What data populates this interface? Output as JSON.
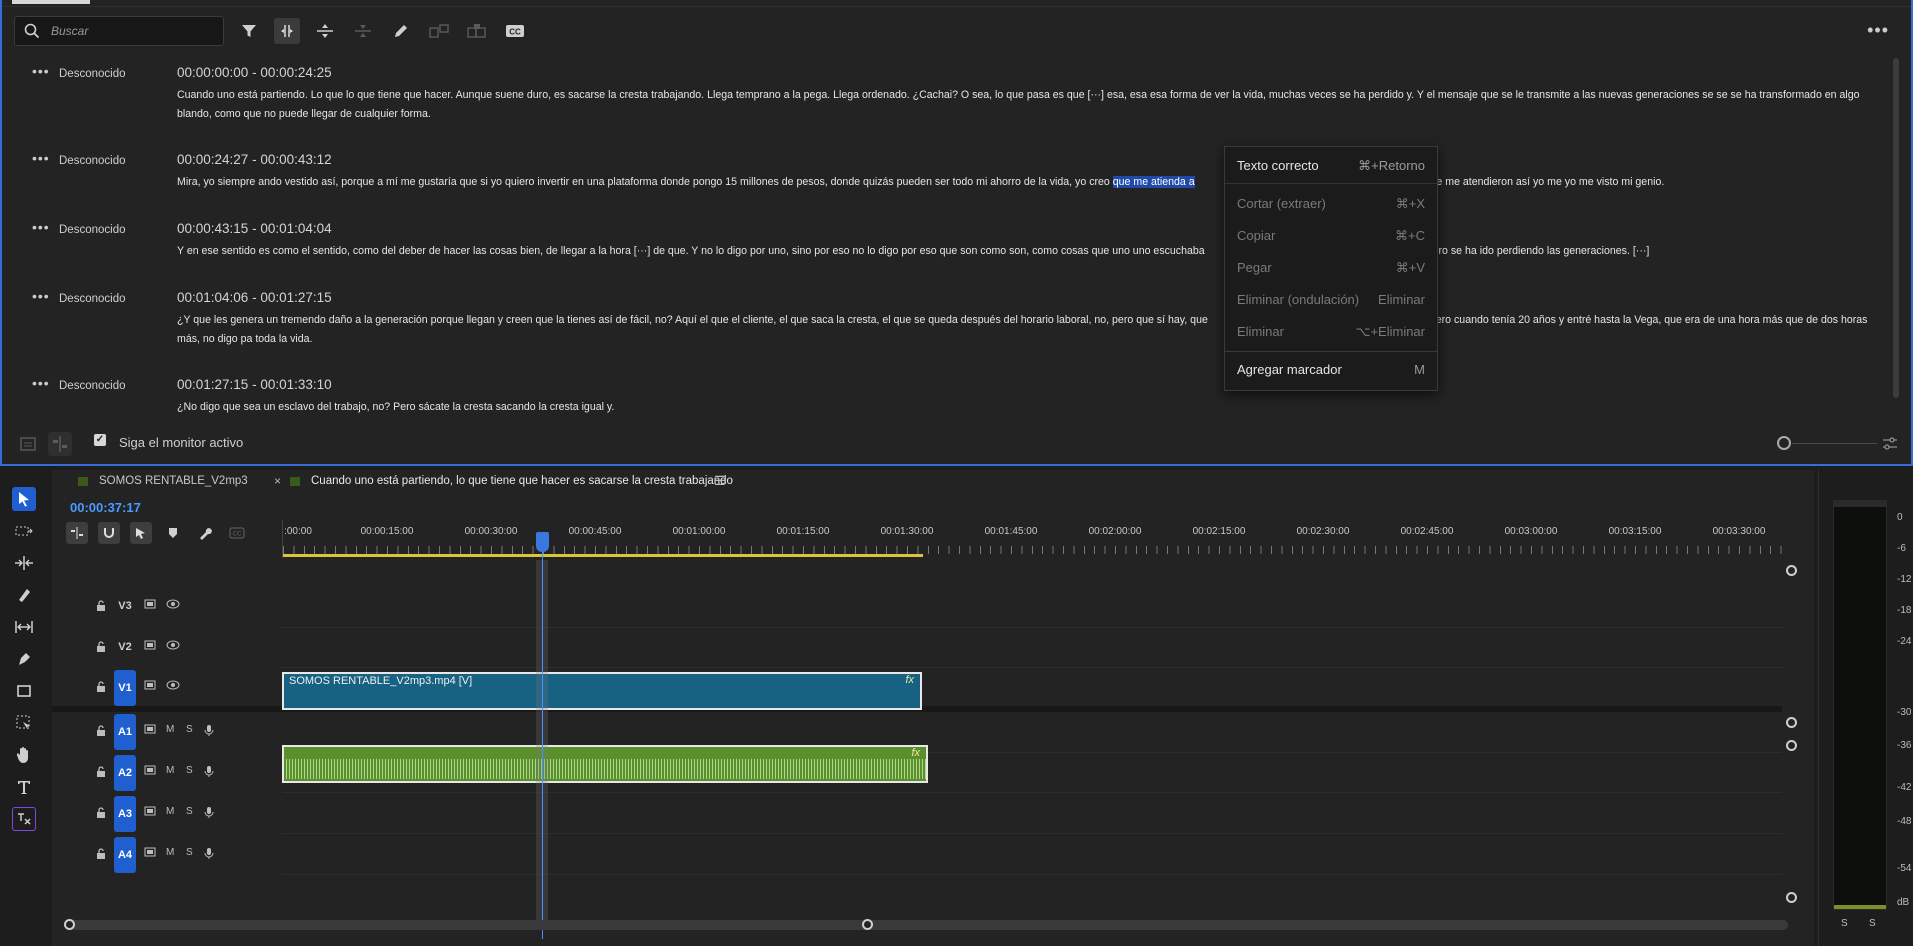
{
  "text_panel": {
    "search": {
      "placeholder": "Buscar"
    },
    "segments": [
      {
        "speaker": "Desconocido",
        "time": "00:00:00:00 - 00:00:24:25",
        "text": "Cuando uno está partiendo. Lo que lo que tiene que hacer. Aunque suene duro, es sacarse la cresta trabajando. Llega temprano a la pega. Llega ordenado. ¿Cachai? O sea, lo que pasa es que [···] esa, esa esa forma de ver la vida, muchas veces se ha perdido y. Y el mensaje que se le transmite a las nuevas generaciones se se se ha transformado en algo blando, como que no puede llegar de cualquier forma."
      },
      {
        "speaker": "Desconocido",
        "time": "00:00:24:27 - 00:00:43:12",
        "text_before": "Mira, yo siempre ando vestido así, porque a mí me gustaría que si yo quiero invertir en una plataforma donde pongo 15 millones de pesos, donde quizás pueden ser todo mi ahorro de la vida, yo creo ",
        "text_highlight": "que me atienda a",
        "text_after": "que me atendieron así yo me yo me visto mi genio."
      },
      {
        "speaker": "Desconocido",
        "time": "00:00:43:15 - 00:01:04:04",
        "text_before": "Y en ese sentido es como el sentido, como del deber de hacer las cosas bien, de llegar a la hora [···] de que. Y no lo digo por uno, sino por eso no lo digo por eso que son como son, como cosas que uno uno escuchaba",
        "text_after": ". Pero se ha ido perdiendo las generaciones. [···]"
      },
      {
        "speaker": "Desconocido",
        "time": "00:01:04:06 - 00:01:27:15",
        "text_before": "¿Y que les genera un tremendo daño a la generación porque llegan y creen que la tienes así de fácil, no? Aquí el que el cliente, el que saca la cresta, el que se queda después del horario laboral, no, pero que sí hay, que",
        "text_after": "pero cuando tenía 20 años y entré hasta la Vega, que era de una hora más que de dos horas más, no digo pa toda la vida."
      },
      {
        "speaker": "Desconocido",
        "time": "00:01:27:15 - 00:01:33:10",
        "text": "¿No digo que sea un esclavo del trabajo, no? Pero sácate la cresta sacando la cresta igual y."
      }
    ],
    "follow_label": "Siga el monitor activo"
  },
  "context_menu": {
    "items": [
      {
        "label": "Texto correcto",
        "shortcut": "⌘+Retorno"
      },
      {
        "label": "Cortar (extraer)",
        "shortcut": "⌘+X"
      },
      {
        "label": "Copiar",
        "shortcut": "⌘+C"
      },
      {
        "label": "Pegar",
        "shortcut": "⌘+V"
      },
      {
        "label": "Eliminar (ondulación)",
        "shortcut": "Eliminar"
      },
      {
        "label": "Eliminar",
        "shortcut": "⌥+Eliminar"
      },
      {
        "label": "Agregar marcador",
        "shortcut": "M"
      }
    ]
  },
  "timeline": {
    "tabs": [
      {
        "label": "SOMOS RENTABLE_V2mp3",
        "close": "×"
      },
      {
        "label": "Cuando uno está partiendo, lo que tiene que hacer es sacarse la cresta trabajando",
        "menu": "☰"
      }
    ],
    "timecode": "00:00:37:17",
    "ruler_labels": [
      ":00:00",
      "00:00:15:00",
      "00:00:30:00",
      "00:00:45:00",
      "00:01:00:00",
      "00:01:15:00",
      "00:01:30:00",
      "00:01:45:00",
      "00:02:00:00",
      "00:02:15:00",
      "00:02:30:00",
      "00:02:45:00",
      "00:03:00:00",
      "00:03:15:00",
      "00:03:30:00"
    ],
    "tracks": {
      "v3": "V3",
      "v2": "V2",
      "v1": "V1",
      "a1": "A1",
      "a2": "A2",
      "a3": "A3",
      "a4": "A4",
      "m": "M",
      "s": "S"
    },
    "video_clip": {
      "label": "SOMOS RENTABLE_V2mp3.mp4 [V]",
      "fx": "fx"
    },
    "audio_clip": {
      "fx": "fx"
    }
  },
  "meter": {
    "db_labels": [
      "0",
      "-6",
      "-12",
      "-18",
      "-24",
      "-30",
      "-36",
      "-42",
      "-48",
      "-54",
      "dB"
    ],
    "ss": [
      "S",
      "S"
    ]
  },
  "colors": {
    "accent": "#1f5fcf",
    "highlight": "#1f4aa8",
    "video_clip": "#176182",
    "audio_clip": "#5b8f2c",
    "timecode": "#4d9aff"
  }
}
